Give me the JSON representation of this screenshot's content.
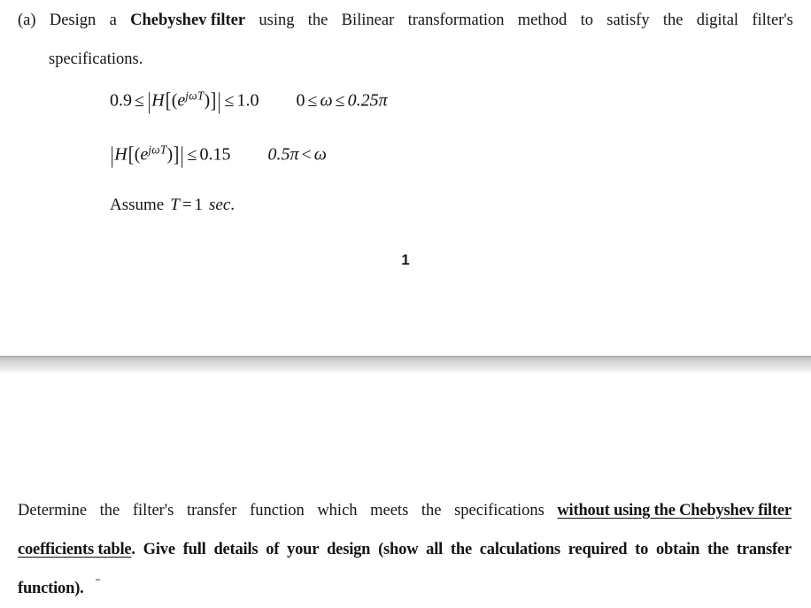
{
  "document": {
    "background_color": "#ffffff",
    "text_color": "#151515",
    "page_divider_color": "#c6c6c6"
  },
  "page_one": {
    "question_label": "(a)",
    "line1": {
      "w1": "(a)",
      "w2": "Design",
      "w3": "a",
      "w4_bold": "Chebyshev filter",
      "w5": "using",
      "w6": "the",
      "w7": "Bilinear",
      "w8": "transformation",
      "w9": "method",
      "w10": "to",
      "w11": "satisfy",
      "w12": "the",
      "w13": "digital",
      "w14": "filter's"
    },
    "line2": "specifications.",
    "equation_1": {
      "lower_bound": "0.9",
      "rel1": "≤",
      "magnitude_open": "|",
      "H": "H",
      "bracket_open": "[",
      "paren_open": "(",
      "base": "e",
      "exponent": "jωT",
      "paren_close": ")",
      "bracket_close": "]",
      "magnitude_close": "|",
      "rel2": "≤",
      "upper_bound": "1.0",
      "range_low": "0",
      "range_rel1": "≤",
      "omega": "ω",
      "range_rel2": "≤",
      "range_high": "0.25π",
      "plain_text": "0.9 ≤ |H[(e^{jωT})]| ≤ 1.0    0 ≤ ω ≤ 0.25π"
    },
    "equation_2": {
      "magnitude_open": "|",
      "H": "H",
      "bracket_open": "[",
      "paren_open": "(",
      "base": "e",
      "exponent": "jωT",
      "paren_close": ")",
      "bracket_close": "]",
      "magnitude_close": "|",
      "rel": "≤",
      "bound": "0.15",
      "range_value": "0.5π",
      "range_rel": "<",
      "omega": "ω",
      "plain_text": "|H[(e^{jωT})]| ≤ 0.15    0.5π < ω"
    },
    "equation_3": {
      "assume": "Assume",
      "symbol": "T",
      "equals": "=",
      "value": "1",
      "unit": "sec",
      "period": ".",
      "plain_text": "Assume T = 1 sec."
    },
    "page_number": "1"
  },
  "page_two": {
    "line1": {
      "w1": "Determine",
      "w2": "the",
      "w3": "filter's",
      "w4": "transfer",
      "w5": "function",
      "w6": "which",
      "w7": "meets",
      "w8": "the",
      "w9": "specifications",
      "w10_bold_underline": "without using the Chebyshev filter"
    },
    "line2": {
      "w1_bold_underline": "coefficients table",
      "w2_bold": ".",
      "w3_bold": "Give",
      "w4_bold": "full",
      "w5_bold": "details",
      "w6_bold": "of",
      "w7_bold": "your",
      "w8_bold": "design",
      "w9_bold": "(show",
      "w10_bold": "all",
      "w11_bold": "the",
      "w12_bold": "calculations",
      "w13_bold": "required",
      "w14_bold": "to",
      "w15_bold": "obtain",
      "w16_bold": "the",
      "w17_bold": "transfer"
    },
    "line3_bold": "function)."
  }
}
